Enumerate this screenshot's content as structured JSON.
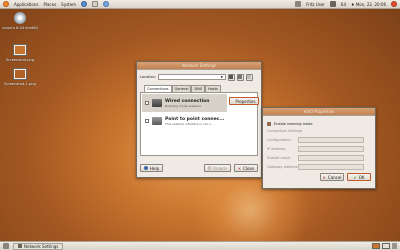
{
  "top_panel": {
    "menus": [
      "Applications",
      "Places",
      "System"
    ],
    "user": "Fritz User",
    "weather": "64",
    "clock": "♦ Mon, 22. 20:06"
  },
  "desktop": {
    "icons": [
      {
        "label": "ubuntu 8.04 amd64"
      },
      {
        "label": "Screenshot.png"
      },
      {
        "label": "Screenshot-1.png"
      }
    ]
  },
  "network_window": {
    "title": "Network Settings",
    "location_label": "Location:",
    "location_value": "",
    "tabs": [
      "Connections",
      "General",
      "DNS",
      "Hosts"
    ],
    "connections": [
      {
        "title": "Wired connection",
        "subtitle": "Roaming mode enabled"
      },
      {
        "title": "Point to point connec...",
        "subtitle": "This network interface is not c..."
      }
    ],
    "properties_label": "Properties",
    "help_label": "Help",
    "unlock_label": "Unlock",
    "close_label": "Close"
  },
  "eth_window": {
    "title": "eth0 Properties",
    "roaming_label": "Enable roaming mode",
    "section_label": "Connection Settings",
    "fields": [
      "Configuration:",
      "IP address:",
      "Subnet mask:",
      "Gateway address:"
    ],
    "cancel_label": "Cancel",
    "ok_label": "OK"
  },
  "bottom_panel": {
    "task_label": "Network Settings"
  },
  "colors": {
    "accent": "#c05a2a",
    "panel": "#e6e1d8"
  }
}
